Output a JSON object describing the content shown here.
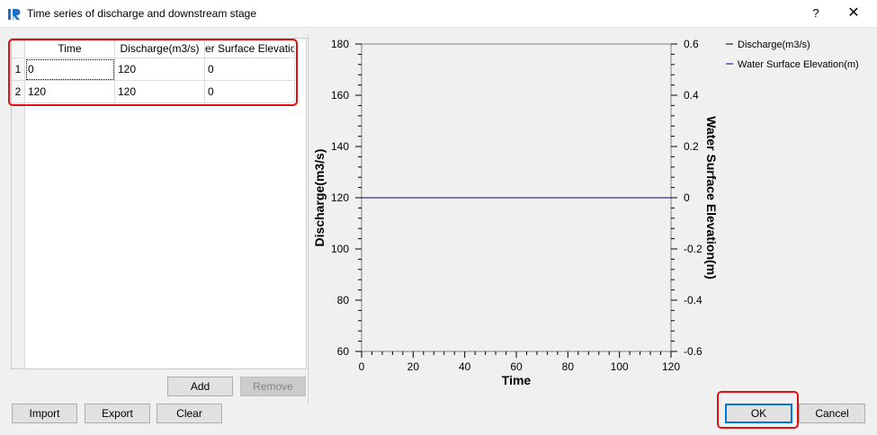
{
  "window": {
    "title": "Time series of discharge and downstream stage",
    "help_label": "?",
    "close_label": "✕"
  },
  "table": {
    "columns": [
      "Time",
      "Discharge(m3/s)",
      "er Surface Elevatio"
    ],
    "row_numbers": [
      "1",
      "2"
    ],
    "rows": [
      [
        "0",
        "120",
        "0"
      ],
      [
        "120",
        "120",
        "0"
      ]
    ]
  },
  "buttons": {
    "add": "Add",
    "remove": "Remove",
    "import": "Import",
    "export": "Export",
    "clear": "Clear",
    "ok": "OK",
    "cancel": "Cancel"
  },
  "chart_data": {
    "type": "line",
    "xlabel": "Time",
    "ylabel": "Discharge(m3/s)",
    "y2label": "Water Surface Elevation(m)",
    "xlim": [
      0,
      120
    ],
    "ylim": [
      60,
      180
    ],
    "y2lim": [
      -0.6,
      0.6
    ],
    "x_ticks": [
      "0",
      "20",
      "40",
      "60",
      "80",
      "100",
      "120"
    ],
    "y_ticks": [
      "60",
      "80",
      "100",
      "120",
      "140",
      "160",
      "180"
    ],
    "y2_ticks": [
      "-0.6",
      "-0.4",
      "-0.2",
      "0",
      "0.2",
      "0.4",
      "0.6"
    ],
    "grid": false,
    "legend_position": "top-right",
    "series": [
      {
        "name": "Discharge(m3/s)",
        "axis": "left",
        "color": "#000000",
        "x": [
          0,
          120
        ],
        "y": [
          120,
          120
        ]
      },
      {
        "name": "Water Surface Elevation(m)",
        "axis": "right",
        "color": "#00008b",
        "x": [
          0,
          120
        ],
        "y": [
          0,
          0
        ]
      }
    ]
  }
}
